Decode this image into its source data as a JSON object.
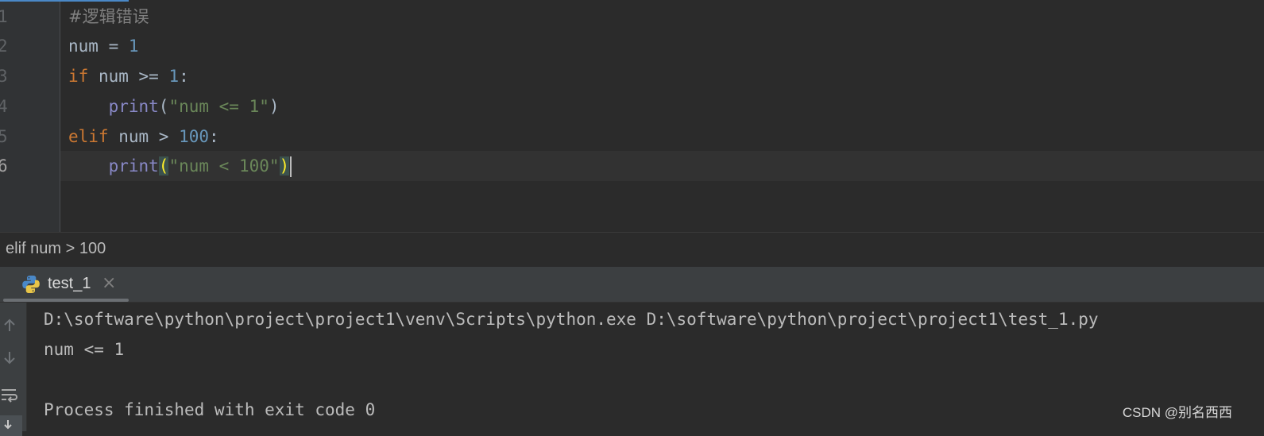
{
  "editor": {
    "line_numbers": [
      "1",
      "2",
      "3",
      "4",
      "5",
      "6"
    ],
    "current_line": "6",
    "lines": {
      "l1": {
        "comment": "#逻辑错误"
      },
      "l2": {
        "var": "num",
        "op": " = ",
        "num": "1"
      },
      "l3": {
        "kw": "if",
        "rest": " num >= ",
        "num": "1",
        "colon": ":"
      },
      "l4": {
        "indent": "    ",
        "fn": "print",
        "open": "(",
        "str": "\"num <= 1\"",
        "close": ")"
      },
      "l5": {
        "kw": "elif",
        "rest": " num > ",
        "num": "100",
        "colon": ":"
      },
      "l6": {
        "indent": "    ",
        "fn": "print",
        "open": "(",
        "str": "\"num < 100\"",
        "close": ")"
      }
    }
  },
  "breadcrumb": {
    "text": "elif num > 100"
  },
  "run_panel": {
    "tab_label": "test_1",
    "tab_close": "×",
    "toolbar_icons": [
      "arrow-up-icon",
      "arrow-down-icon",
      "soft-wrap-icon",
      "scroll-to-end-icon"
    ],
    "console_lines": [
      "D:\\software\\python\\project\\project1\\venv\\Scripts\\python.exe D:\\software\\python\\project\\project1\\test_1.py",
      "num <= 1",
      "",
      "Process finished with exit code 0"
    ]
  },
  "watermark": "CSDN @别名西西",
  "colors": {
    "keyword": "#cc7832",
    "number": "#6897bb",
    "string": "#6a8759",
    "builtin": "#8888c6",
    "comment": "#808080",
    "text": "#a9b7c6",
    "background": "#2b2b2b"
  }
}
